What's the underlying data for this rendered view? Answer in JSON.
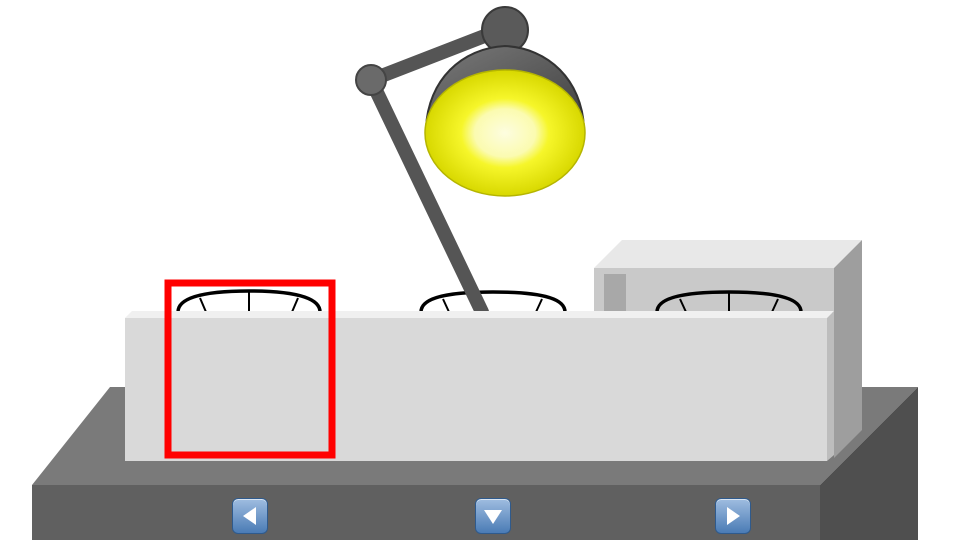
{
  "scene": {
    "lamp_state": "on",
    "cup_count": 3,
    "selected_slot": 1,
    "colors": {
      "table_top": "#7a7a7a",
      "table_front": "#5a5a5a",
      "table_side": "#4a4a4a",
      "box_front": "#d9d9d9",
      "lamp_body": "#595959",
      "lamp_light": "#f4f40a",
      "selection": "#ff0000"
    }
  },
  "controls": {
    "left_icon": "arrow-left-icon",
    "down_icon": "arrow-down-icon",
    "right_icon": "arrow-right-icon"
  }
}
